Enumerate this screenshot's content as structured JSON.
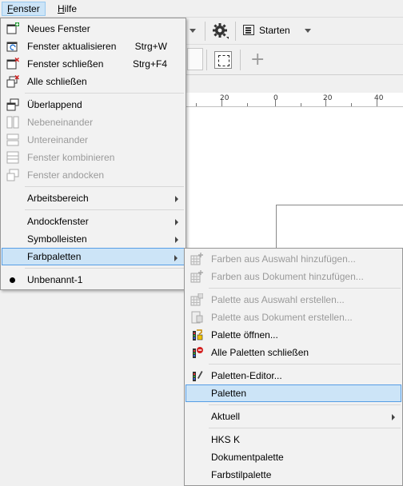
{
  "menubar": {
    "items": [
      {
        "label": "Fenster",
        "mnemonic": "F",
        "rest": "enster",
        "active": true
      },
      {
        "label": "Hilfe",
        "mnemonic": "H",
        "rest": "ilfe",
        "active": false
      }
    ]
  },
  "toolbar": {
    "starten_label": "Starten"
  },
  "ruler": {
    "labels": [
      "20",
      "0",
      "20",
      "40"
    ]
  },
  "fenster_menu": {
    "items": [
      {
        "label": "Neues Fenster",
        "shortcut": "",
        "icon": "new-window-icon",
        "disabled": false
      },
      {
        "label": "Fenster aktualisieren",
        "shortcut": "Strg+W",
        "icon": "refresh-window-icon",
        "disabled": false
      },
      {
        "label": "Fenster schließen",
        "shortcut": "Strg+F4",
        "icon": "close-window-icon",
        "disabled": false
      },
      {
        "label": "Alle schließen",
        "shortcut": "",
        "icon": "close-all-icon",
        "disabled": false
      },
      {
        "label": "Überlappend",
        "shortcut": "",
        "icon": "cascade-icon",
        "disabled": false
      },
      {
        "label": "Nebeneinander",
        "shortcut": "",
        "icon": "tile-vertical-icon",
        "disabled": true
      },
      {
        "label": "Untereinander",
        "shortcut": "",
        "icon": "tile-horizontal-icon",
        "disabled": true
      },
      {
        "label": "Fenster kombinieren",
        "shortcut": "",
        "icon": "combine-icon",
        "disabled": true
      },
      {
        "label": "Fenster andocken",
        "shortcut": "",
        "icon": "dock-icon",
        "disabled": true
      },
      {
        "label": "Arbeitsbereich",
        "shortcut": "",
        "icon": "",
        "disabled": false,
        "submenu": true
      },
      {
        "label": "Andockfenster",
        "shortcut": "",
        "icon": "",
        "disabled": false,
        "submenu": true
      },
      {
        "label": "Symbolleisten",
        "shortcut": "",
        "icon": "",
        "disabled": false,
        "submenu": true
      },
      {
        "label": "Farbpaletten",
        "shortcut": "",
        "icon": "",
        "disabled": false,
        "submenu": true,
        "highlighted": true
      },
      {
        "label": "Unbenannt-1",
        "shortcut": "",
        "icon": "bullet-icon",
        "disabled": false
      }
    ]
  },
  "farbpaletten_menu": {
    "items": [
      {
        "label": "Farben aus Auswahl hinzufügen...",
        "icon": "add-from-selection-icon",
        "disabled": true
      },
      {
        "label": "Farben aus Dokument hinzufügen...",
        "icon": "add-from-document-icon",
        "disabled": true
      },
      {
        "label": "Palette aus Auswahl erstellen...",
        "icon": "create-from-selection-icon",
        "disabled": true
      },
      {
        "label": "Palette aus Dokument erstellen...",
        "icon": "create-from-document-icon",
        "disabled": true
      },
      {
        "label": "Palette öffnen...",
        "icon": "open-palette-icon",
        "disabled": false
      },
      {
        "label": "Alle Paletten schließen",
        "icon": "close-palettes-icon",
        "disabled": false
      },
      {
        "label": "Paletten-Editor...",
        "icon": "palette-editor-icon",
        "disabled": false
      },
      {
        "label": "Paletten",
        "icon": "",
        "disabled": false,
        "highlighted": true
      },
      {
        "label": "Aktuell",
        "icon": "",
        "disabled": false,
        "submenu": true
      },
      {
        "label": "HKS K",
        "icon": "",
        "disabled": false
      },
      {
        "label": "Dokumentpalette",
        "icon": "",
        "disabled": false
      },
      {
        "label": "Farbstilpalette",
        "icon": "",
        "disabled": false
      }
    ]
  },
  "colors": {
    "highlight_bg": "#cce4f7",
    "highlight_border": "#569de5",
    "disabled_text": "#9a9a9a"
  }
}
